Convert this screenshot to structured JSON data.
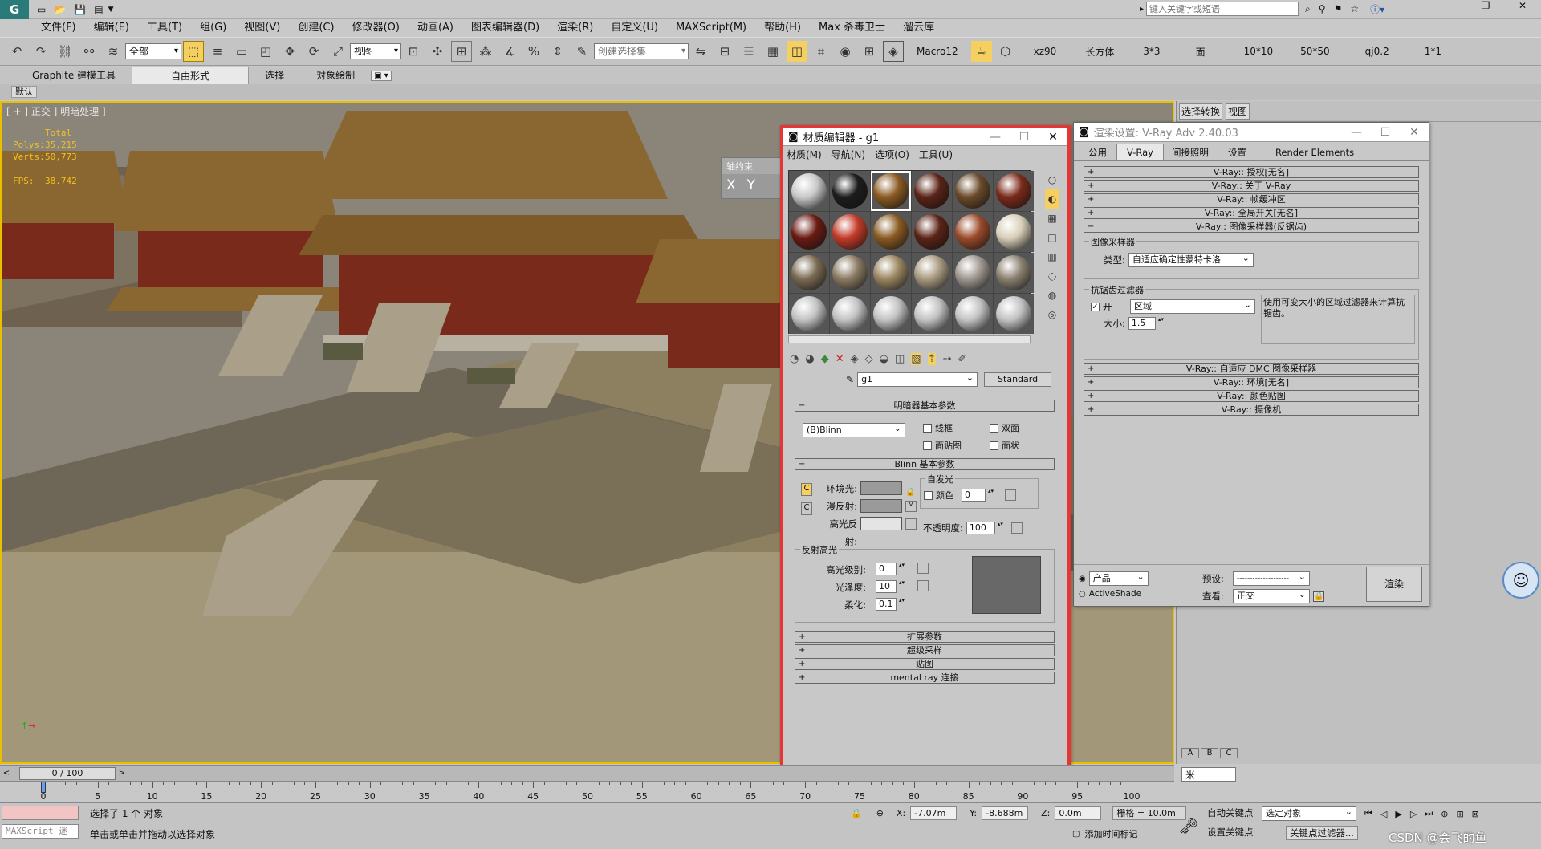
{
  "app": {
    "quick_search_placeholder": "键入关键字或短语"
  },
  "menu": [
    "文件(F)",
    "编辑(E)",
    "工具(T)",
    "组(G)",
    "视图(V)",
    "创建(C)",
    "修改器(O)",
    "动画(A)",
    "图表编辑器(D)",
    "渲染(R)",
    "自定义(U)",
    "MAXScript(M)",
    "帮助(H)",
    "Max 杀毒卫士",
    "溜云库"
  ],
  "toolbar": {
    "selection_filter": "全部",
    "ref_coord": "视图",
    "named_selection": "创建选择集",
    "macros": [
      "Macro12",
      "xz90",
      "长方体",
      "3*3",
      "面",
      "10*10",
      "50*50",
      "qj0.2",
      "1*1"
    ]
  },
  "ribbon": {
    "tabs": [
      "Graphite 建模工具",
      "自由形式",
      "选择",
      "对象绘制"
    ],
    "active_tab": "自由形式",
    "sub_label": "默认"
  },
  "viewport": {
    "label": "[ + ] 正交 ] 明暗处理 ]",
    "stats": {
      "total": "Total",
      "polys_label": "Polys:",
      "polys": "35,215",
      "verts_label": "Verts:",
      "verts": "50,773",
      "fps_label": "FPS:",
      "fps": "38.742"
    },
    "axis_window_title": "轴约束",
    "axis_buttons": [
      "X",
      "Y"
    ]
  },
  "material_editor": {
    "title": "材质编辑器 - g1",
    "menu": [
      "材质(M)",
      "导航(N)",
      "选项(O)",
      "工具(U)"
    ],
    "material_name": "g1",
    "material_type": "Standard",
    "shader_rollout": "明暗器基本参数",
    "shader": "(B)Blinn",
    "shader_checks": [
      "线框",
      "双面",
      "面贴图",
      "面状"
    ],
    "blinn_rollout": "Blinn 基本参数",
    "ambient_label": "环境光:",
    "diffuse_label": "漫反射:",
    "specular_label": "高光反射:",
    "map_btn": "M",
    "self_illum_title": "自发光",
    "color_label": "颜色",
    "color_value": "0",
    "opacity_label": "不透明度:",
    "opacity_value": "100",
    "spec_group": "反射高光",
    "spec_level_label": "高光级别:",
    "spec_level": "0",
    "glossiness_label": "光泽度:",
    "glossiness": "10",
    "soften_label": "柔化:",
    "soften": "0.1",
    "rollouts": [
      "扩展参数",
      "超级采样",
      "贴图",
      "mental ray 连接"
    ],
    "sphere_colors": [
      "#c9c9c9",
      "#1c1c1c",
      "#8a5a22",
      "#5a2316",
      "#6a4a2a",
      "#7a2a1a",
      "#6a1a12",
      "#c23a28",
      "#8a5a22",
      "#5a2316",
      "#9a4a2a",
      "#d8cfb8",
      "#7a6a52",
      "#8a7a62",
      "#9a8560",
      "#a89a80",
      "#a09890",
      "#8a8070",
      "#c2c2c2",
      "#c2c2c2",
      "#c2c2c2",
      "#c2c2c2",
      "#c2c2c2",
      "#c2c2c2"
    ]
  },
  "render_setup": {
    "title": "渲染设置: V-Ray Adv 2.40.03",
    "tabs": [
      "公用",
      "V-Ray",
      "间接照明",
      "设置",
      "Render Elements"
    ],
    "active_tab": "V-Ray",
    "rollouts_top": [
      "V-Ray:: 授权[无名]",
      "V-Ray:: 关于 V-Ray",
      "V-Ray:: 帧缓冲区",
      "V-Ray:: 全局开关[无名]",
      "V-Ray:: 图像采样器(反锯齿)"
    ],
    "image_sampler_group": "图像采样器",
    "type_label": "类型:",
    "type_value": "自适应确定性蒙特卡洛",
    "aa_group": "抗锯齿过滤器",
    "on_label": "开",
    "filter_value": "区域",
    "filter_desc": "使用可变大小的区域过滤器来计算抗锯齿。",
    "size_label": "大小:",
    "size_value": "1.5",
    "rollouts_bottom": [
      "V-Ray:: 自适应 DMC 图像采样器",
      "V-Ray:: 环境[无名]",
      "V-Ray:: 颜色贴图",
      "V-Ray:: 摄像机"
    ],
    "product_label": "产品",
    "activeshade_label": "ActiveShade",
    "preset_label": "预设:",
    "preset_value": "--------------------",
    "view_label": "查看:",
    "view_value": "正交",
    "render_button": "渲染"
  },
  "cmdpanel": {
    "tabs": [
      "选择转换",
      "视图"
    ],
    "abc": [
      "A",
      "B",
      "C"
    ],
    "unit": "米"
  },
  "timeline": {
    "frame": "0 / 100",
    "ticks": [
      "0",
      "5",
      "10",
      "15",
      "20",
      "25",
      "30",
      "35",
      "40",
      "45",
      "50",
      "55",
      "60",
      "65",
      "70",
      "75",
      "80",
      "85",
      "90",
      "95",
      "100"
    ]
  },
  "status": {
    "maxscript": "MAXScript 迷",
    "selected": "选择了 1 个 对象",
    "prompt": "单击或单击并拖动以选择对象",
    "x_label": "X:",
    "x": "-7.07m",
    "y_label": "Y:",
    "y": "-8.688m",
    "z_label": "Z:",
    "z": "0.0m",
    "grid": "栅格 = 10.0m",
    "add_time_tag": "添加时间标记",
    "auto_key": "自动关键点",
    "set_key": "设置关键点",
    "key_filter_sel": "选定对象",
    "key_filters": "关键点过滤器...",
    "watermark": "CSDN @会飞的鱼"
  }
}
